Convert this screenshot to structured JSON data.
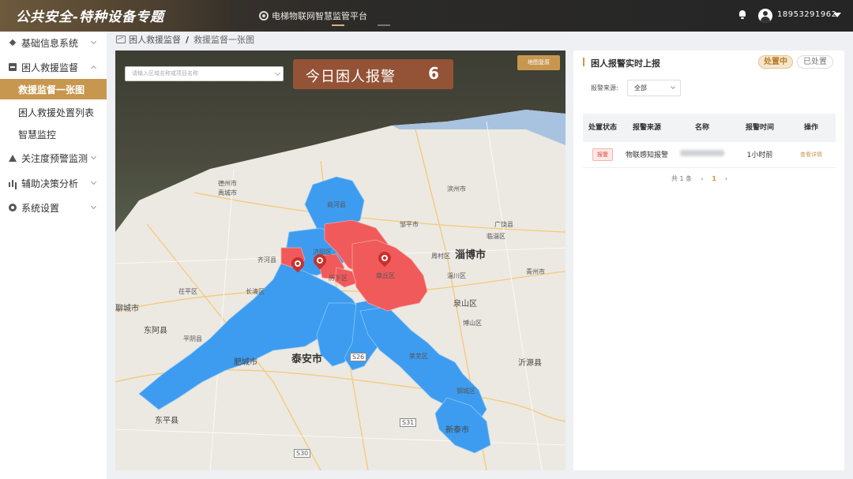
{
  "header": {
    "brand_title": "公共安全-特种设备专题",
    "platform_name": "电梯物联网智慧监管平台",
    "username": "18953291962"
  },
  "sidebar": {
    "items": [
      {
        "label": "基础信息系统",
        "icon": "layers-icon"
      },
      {
        "label": "困人救援监督",
        "icon": "box-icon"
      },
      {
        "label": "关注度预警监测",
        "icon": "warning-icon"
      },
      {
        "label": "辅助决策分析",
        "icon": "bar-chart-icon"
      },
      {
        "label": "系统设置",
        "icon": "gear-icon"
      }
    ],
    "sub_items": [
      {
        "label": "救援监督一张图"
      },
      {
        "label": "困人救援处置列表"
      },
      {
        "label": "智慧监控"
      }
    ]
  },
  "breadcrumb": {
    "parent": "困人救援监督",
    "separator": "/",
    "current": "救援监督一张图"
  },
  "map": {
    "search_placeholder": "请输入区域名称或项目名称",
    "alarm_label": "今日困人报警",
    "alarm_count": "6",
    "reset_label": "地图复原",
    "labels": {
      "taian": "泰安市",
      "zibo": "淄博市",
      "feicheng": "肥城市",
      "xintai": "新泰市",
      "laiwu": "莱芜区",
      "gangcheng": "钢城区",
      "changqing": "长清区",
      "pingyin": "平阴县",
      "dongping": "东平县",
      "dong_e": "东阿县",
      "liaocheng": "聊城市",
      "yiyuan": "沂源县",
      "zhangqiu": "章丘区",
      "jiyang": "济阳区",
      "shanghe": "商河县",
      "dezhou": "德州市",
      "yucheng": "禹城市",
      "qihe": "齐河县",
      "lixia": "历下区",
      "zhoucun": "周村区",
      "zichuan": "淄川区",
      "boshan": "博山区",
      "linzi": "临淄区",
      "qingzhou": "青州市",
      "guangrao": "广饶县",
      "binzhou": "滨州市",
      "zouping": "邹平市",
      "chiping": "茌平区",
      "yinshan": "泉山区"
    },
    "highway_labels": [
      "S26",
      "S31",
      "S30"
    ]
  },
  "panel": {
    "title": "困人报警实时上报",
    "tabs": [
      "处置中",
      "已处置"
    ],
    "source_label": "报警来源:",
    "source_value": "全部",
    "table": {
      "headers": [
        "处置状态",
        "报警来源",
        "名称",
        "报警时间",
        "操作"
      ],
      "rows": [
        {
          "status": "报警",
          "source": "物联感知报警",
          "time": "1小时前",
          "action": "查看详情"
        }
      ]
    },
    "pagination": {
      "total_text": "共 1 条",
      "prev": "‹",
      "page": "1",
      "next": "›"
    }
  },
  "colors": {
    "accent": "#c8974f",
    "blue_region": "#3d9cf0",
    "red_region": "#f05a5a"
  }
}
